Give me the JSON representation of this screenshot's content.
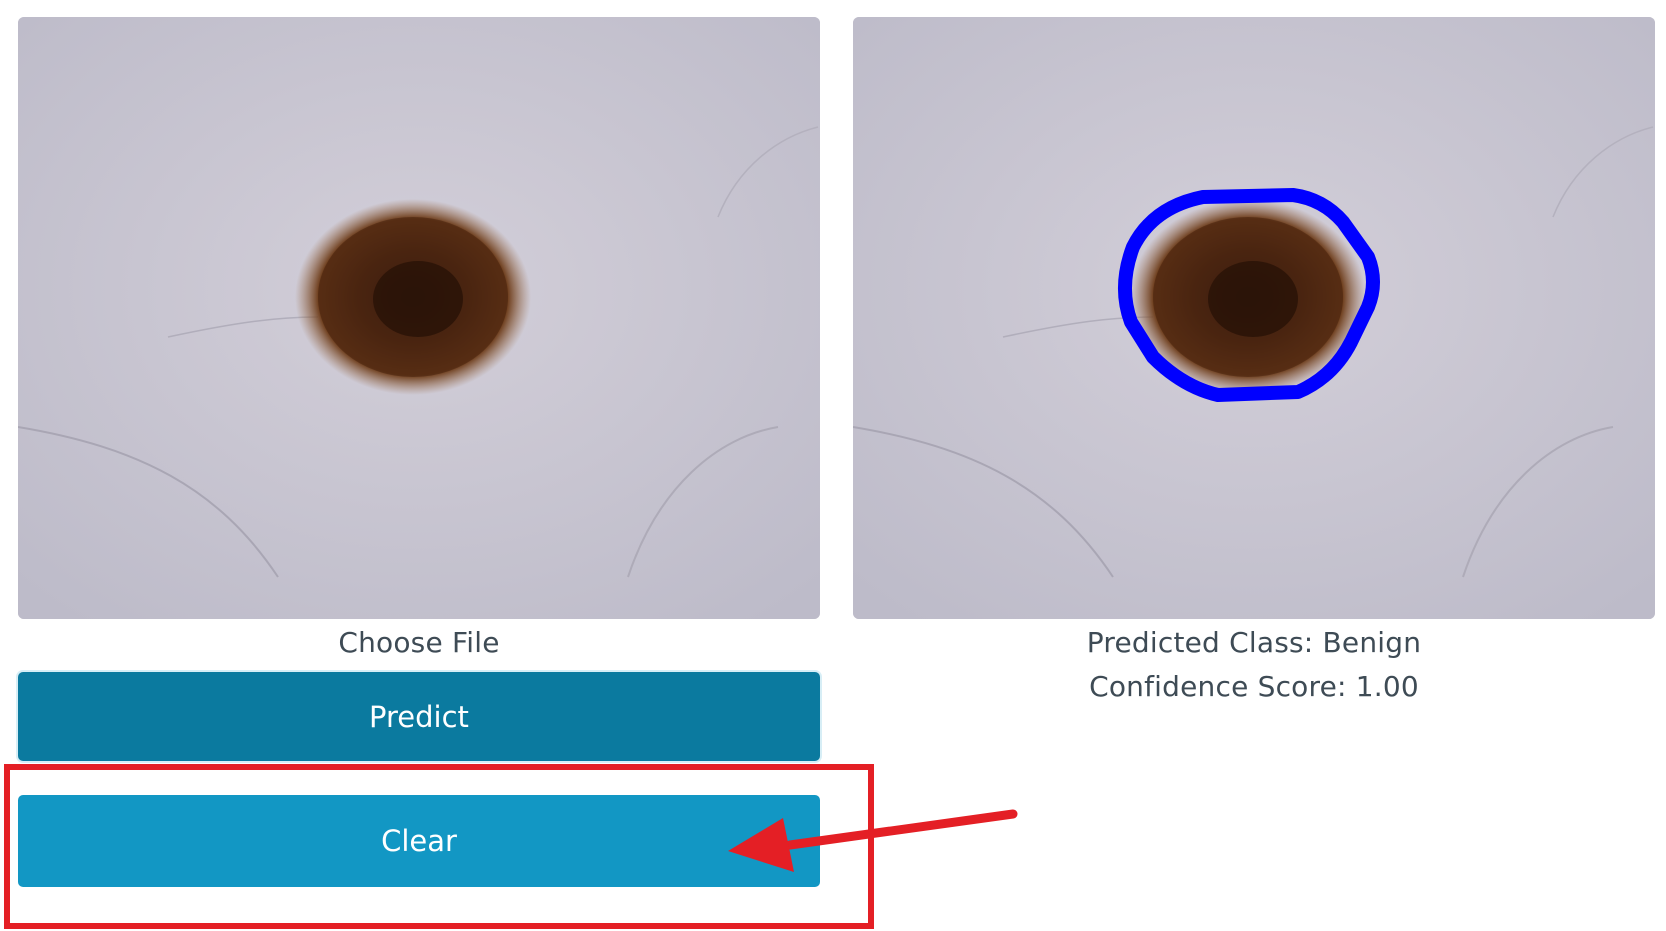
{
  "input_panel": {
    "image_icon": "skin-lesion-photo",
    "choose_file_label": "Choose File"
  },
  "output_panel": {
    "image_icon": "segmented-lesion-photo",
    "predicted_class_text": "Predicted Class: Benign",
    "confidence_text": "Confidence Score: 1.00"
  },
  "actions": {
    "predict_label": "Predict",
    "clear_label": "Clear"
  },
  "annotation": {
    "highlight_color": "#e41f25",
    "arrow_color": "#e41f25",
    "outline_color": "#0000ff"
  }
}
